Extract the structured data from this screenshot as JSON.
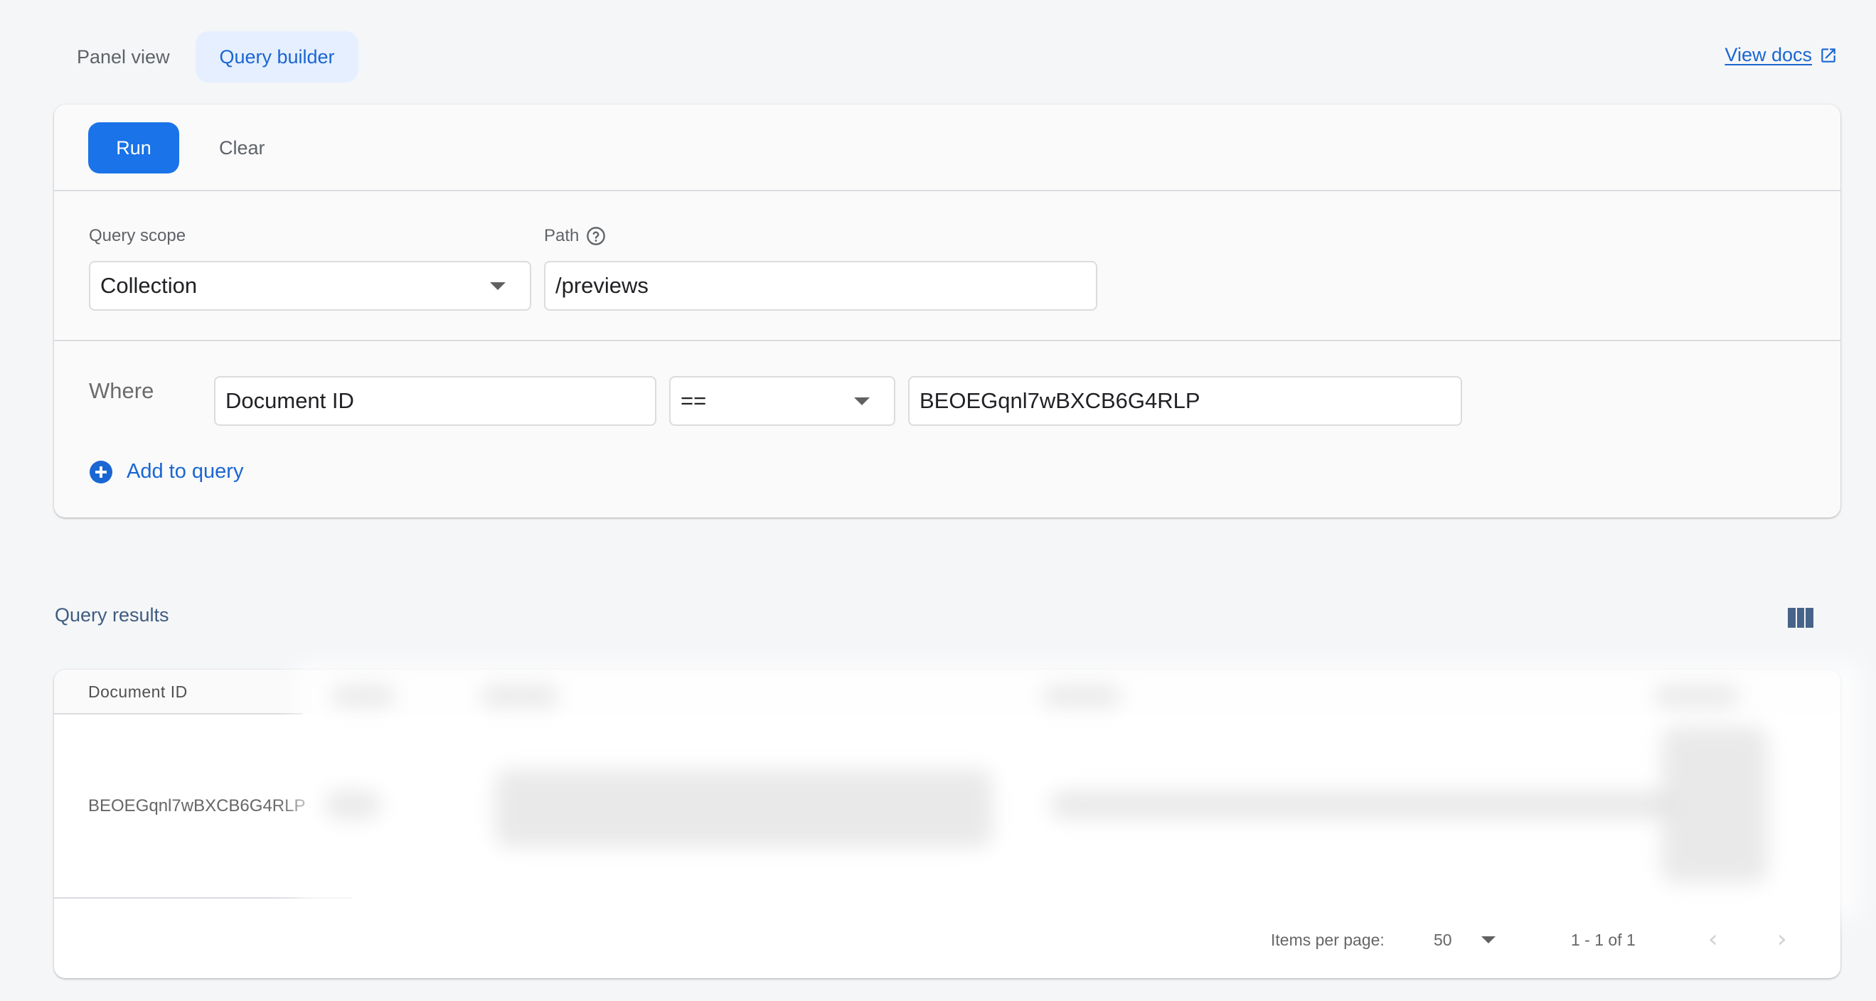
{
  "tabs": [
    {
      "label": "Panel view",
      "active": false
    },
    {
      "label": "Query builder",
      "active": true
    }
  ],
  "docs_link": {
    "label": "View docs",
    "icon": "open-in-new-icon"
  },
  "toolbar": {
    "run_label": "Run",
    "clear_label": "Clear"
  },
  "scope": {
    "label": "Query scope",
    "value": "Collection"
  },
  "path": {
    "label": "Path",
    "help_icon": "help-circle-icon",
    "value": "/previews"
  },
  "where": {
    "label": "Where",
    "field": "Document ID",
    "operator": "==",
    "value": "BEOEGqnl7wBXCB6G4RLP"
  },
  "add_to_query": {
    "label": "Add to query",
    "icon": "add-circle-icon"
  },
  "results": {
    "title": "Query results",
    "columns_icon": "view-column-icon",
    "columns": [
      "Document ID"
    ],
    "rows": [
      {
        "document_id": "BEOEGqnl7wBXCB6G4RLP"
      }
    ],
    "redacted": true
  },
  "paginator": {
    "items_per_page_label": "Items per page:",
    "page_size": "50",
    "range_label": "1 - 1 of 1",
    "prev_icon": "chevron-left-icon",
    "next_icon": "chevron-right-icon"
  },
  "colors": {
    "accent": "#1a73e8",
    "link": "#1a66d2",
    "tab_active_bg": "#e5efff",
    "results_title": "#3f5c80",
    "background": "#f5f6f8"
  }
}
